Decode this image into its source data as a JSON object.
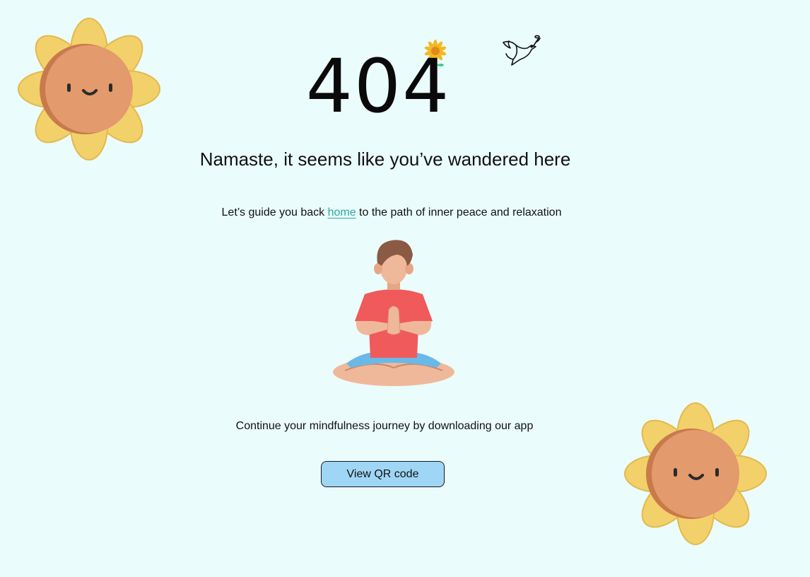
{
  "error": {
    "code": "404"
  },
  "headline": "Namaste, it seems like you’ve wandered here",
  "guide": {
    "before": "Let’s guide you back ",
    "link_label": "home",
    "after": " to the path of inner peace and relaxation"
  },
  "cta": {
    "text": "Continue your mindfulness journey by downloading our app",
    "button_label": "View QR code"
  },
  "icons": {
    "top_left": "smiling-sun-flower-icon",
    "bottom_right": "smiling-sun-flower-icon",
    "small_flower": "daisy-flower-icon",
    "bird": "dove-icon",
    "center": "meditating-person-icon"
  },
  "colors": {
    "background": "#ebfcfc",
    "link": "#2aa8a8",
    "button": "#9fd6f5",
    "petal": "#f2d16b",
    "leaf": "#3ccf8e",
    "face": "#e39a6c",
    "shirt": "#f05a5a",
    "pants": "#6ab8e8"
  }
}
